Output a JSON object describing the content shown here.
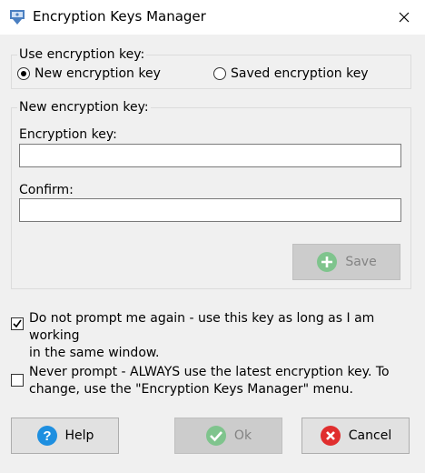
{
  "window": {
    "title": "Encryption Keys Manager",
    "icons": {
      "app": "key-manager-icon",
      "close": "close-icon"
    }
  },
  "use_key_group": {
    "title": "Use encryption key:",
    "options": [
      {
        "label": "New encryption key",
        "selected": true
      },
      {
        "label": "Saved encryption key",
        "selected": false
      }
    ]
  },
  "new_key_group": {
    "title": "New encryption key:",
    "key_label": "Encryption key:",
    "key_value": "",
    "confirm_label": "Confirm:",
    "confirm_value": "",
    "save_label": "Save",
    "save_enabled": false
  },
  "options": {
    "do_not_prompt": {
      "checked": true,
      "line1": "Do not prompt me again - use this key as long as I am working",
      "line2": "in the same window."
    },
    "never_prompt": {
      "checked": false,
      "line1": "Never prompt - ALWAYS use the latest encryption key.  To",
      "line2": "change, use the \"Encryption Keys Manager\" menu."
    }
  },
  "footer": {
    "help_label": "Help",
    "ok_label": "Ok",
    "ok_enabled": false,
    "cancel_label": "Cancel"
  },
  "colors": {
    "help_icon": "#1e8fe0",
    "ok_icon": "#7fc48d",
    "cancel_icon": "#e02e2e",
    "save_icon": "#7fc48d"
  }
}
